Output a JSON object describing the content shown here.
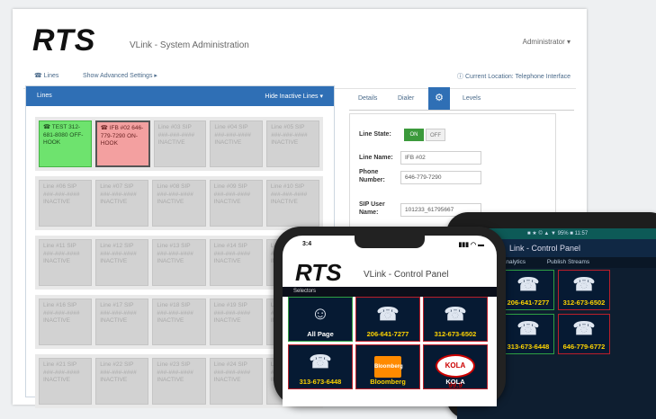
{
  "header": {
    "logo": "RTS",
    "title": "VLink - System Administration",
    "user": "Administrator ▾"
  },
  "nav": {
    "lines_link": "☎ Lines",
    "advanced": "Show Advanced Settings ▸",
    "location": "ⓘ Current Location: Telephone Interface"
  },
  "lines_panel": {
    "title": "Lines",
    "hide_inactive": "Hide Inactive Lines ▾",
    "rows": [
      [
        {
          "text": "☎ TEST 312-681-8080 OFF-HOOK",
          "state": "green"
        },
        {
          "text": "☎ IFB #02 646-779-7290 ON-HOOK",
          "state": "red"
        },
        {
          "text": "Line #03 SIP ###-###-#### INACTIVE",
          "state": "inactive"
        },
        {
          "text": "Line #04 SIP ###-###-#### INACTIVE",
          "state": "inactive"
        },
        {
          "text": "Line #05 SIP ###-###-#### INACTIVE",
          "state": "inactive"
        }
      ],
      [
        {
          "text": "Line #06 SIP ###-###-#### INACTIVE",
          "state": "inactive"
        },
        {
          "text": "Line #07 SIP ###-###-#### INACTIVE",
          "state": "inactive"
        },
        {
          "text": "Line #08 SIP ###-###-#### INACTIVE",
          "state": "inactive"
        },
        {
          "text": "Line #09 SIP ###-###-#### INACTIVE",
          "state": "inactive"
        },
        {
          "text": "Line #10 SIP ###-###-#### INACTIVE",
          "state": "inactive"
        }
      ],
      [
        {
          "text": "Line #11 SIP ###-###-#### INACTIVE",
          "state": "inactive"
        },
        {
          "text": "Line #12 SIP ###-###-#### INACTIVE",
          "state": "inactive"
        },
        {
          "text": "Line #13 SIP ###-###-#### INACTIVE",
          "state": "inactive"
        },
        {
          "text": "Line #14 SIP ###-###-#### INACTIVE",
          "state": "inactive"
        },
        {
          "text": "Line #15 SIP ###-###-#### INACTIVE",
          "state": "inactive"
        }
      ],
      [
        {
          "text": "Line #16 SIP ###-###-#### INACTIVE",
          "state": "inactive"
        },
        {
          "text": "Line #17 SIP ###-###-#### INACTIVE",
          "state": "inactive"
        },
        {
          "text": "Line #18 SIP ###-###-#### INACTIVE",
          "state": "inactive"
        },
        {
          "text": "Line #19 SIP ###-###-#### INACTIVE",
          "state": "inactive"
        },
        {
          "text": "Line #20 SIP ###-###-#### INACTIVE",
          "state": "inactive"
        }
      ],
      [
        {
          "text": "Line #21 SIP ###-###-#### INACTIVE",
          "state": "inactive"
        },
        {
          "text": "Line #22 SIP ###-###-#### INACTIVE",
          "state": "inactive"
        },
        {
          "text": "Line #23 SIP ###-###-#### INACTIVE",
          "state": "inactive"
        },
        {
          "text": "Line #24 SIP ###-###-#### INACTIVE",
          "state": "inactive"
        },
        {
          "text": "Line #25 SIP ###-###-#### INACTIVE",
          "state": "inactive"
        }
      ]
    ]
  },
  "tabs": {
    "details": "Details",
    "dialer": "Dialer",
    "gear": "⚙",
    "levels": "Levels"
  },
  "detail": {
    "line_state_label": "Line State:",
    "on": "ON",
    "off": "OFF",
    "line_name_label": "Line Name:",
    "line_name_value": "IFB #02",
    "phone_label": "Phone Number:",
    "phone_value": "646-779-7290",
    "sip_label": "SIP User Name:",
    "sip_value": "101233_61795667"
  },
  "phone_back": {
    "status": "■ ★ © ▲ ▼ 95% ■ 11:57",
    "title": "Link - Control Panel",
    "tabs": [
      "Analytics",
      "Publish Streams"
    ],
    "tiles": [
      {
        "label": "206-641-7277"
      },
      {
        "label": "312-673-6502"
      },
      {
        "label": "313-673-6448"
      },
      {
        "label": "646-779-6772"
      }
    ]
  },
  "phone_front": {
    "time": "3:4",
    "signal": "▮▮▮ ◠ ▬",
    "logo": "RTS",
    "title": "VLink - Control Panel",
    "selectors": "Selectors",
    "tiles": [
      {
        "label": "All Page",
        "kind": "group",
        "icon": "group-icon"
      },
      {
        "label": "206-641-7277",
        "kind": "sip",
        "icon": "phone-icon"
      },
      {
        "label": "312-673-6502",
        "kind": "sip",
        "icon": "phone-icon"
      },
      {
        "label": "313-673-6448",
        "kind": "sip",
        "icon": "phone-icon"
      },
      {
        "label": "Bloomberg",
        "kind": "bloomberg",
        "icon": "bloomberg-logo"
      },
      {
        "label": "KOLA",
        "kind": "kola",
        "icon": "kola-logo"
      }
    ],
    "bloomberg_logo": "Bloomberg",
    "kola_logo": "KOLA 99.9"
  }
}
